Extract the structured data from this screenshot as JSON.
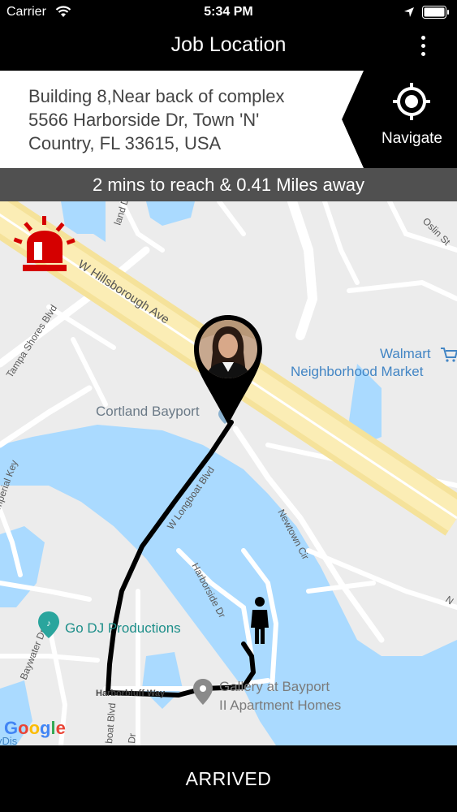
{
  "status_bar": {
    "carrier": "Carrier",
    "time": "5:34 PM"
  },
  "header": {
    "title": "Job Location"
  },
  "address": {
    "line1": "Building 8,Near back of complex",
    "line2": "5566 Harborside Dr, Town 'N'",
    "line3": "Country, FL 33615, USA",
    "navigate_label": "Navigate"
  },
  "eta": {
    "text": "2 mins to reach & 0.41 Miles away"
  },
  "map": {
    "labels": {
      "w_hillsborough": "W Hillsborough Ave",
      "walmart_1": "Walmart",
      "walmart_2": "Neighborhood Market",
      "cortland": "Cortland Bayport",
      "tampa_shores": "Tampa Shores Blvd",
      "w_longboat": "W Longboat Blvd",
      "newtown": "Newtown Cir",
      "harborside": "Harborside Dr",
      "go_dj": "Go DJ Productions",
      "baywater": "Baywater Dr",
      "harborbluff": "Harborbluff Way",
      "gallery_1": "Gallery at Bayport",
      "gallery_2": "II Apartment Homes",
      "longboat_short": "boat Blvd",
      "oslin": "Oslin St",
      "land_dr": "land Dr",
      "imperial": "mperial Key",
      "google": "Google",
      "edge_dr": "Dr",
      "edge_n": "N",
      "edge_dis": "yDis"
    },
    "colors": {
      "route": "#000000",
      "alarm": "#d50000",
      "water": "#aadaff",
      "highway": "#f8e8a0"
    }
  },
  "footer": {
    "arrived_label": "ARRIVED"
  }
}
